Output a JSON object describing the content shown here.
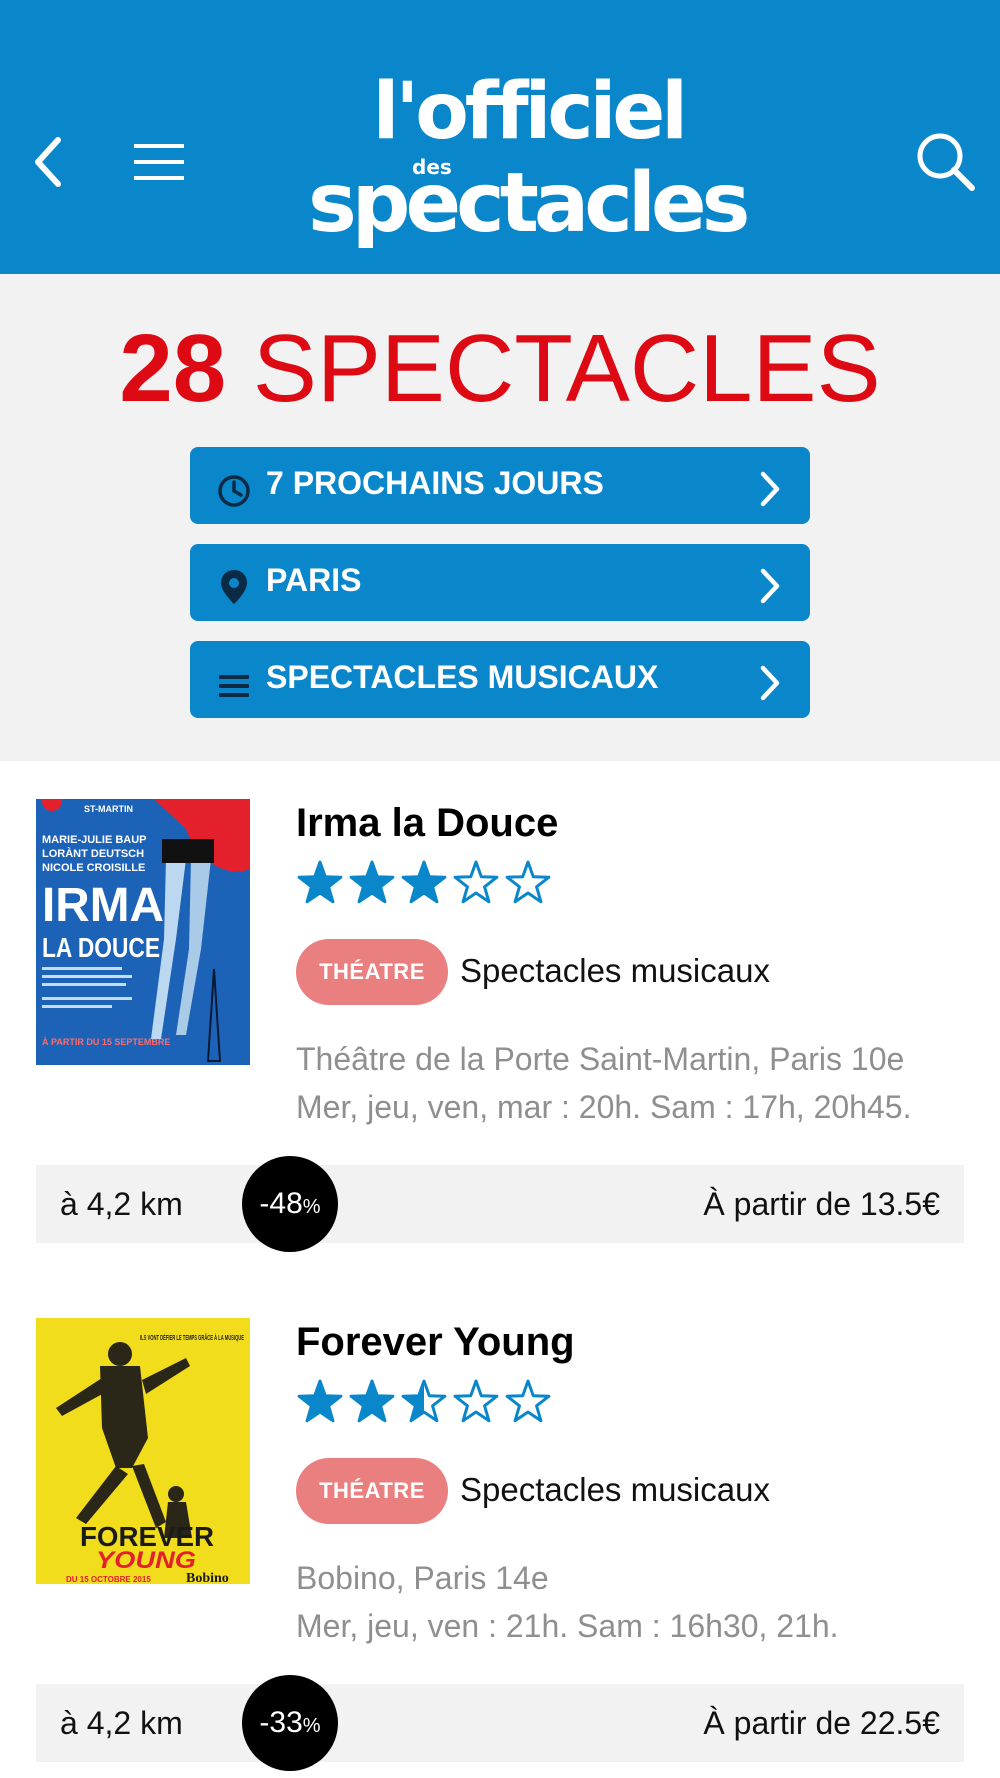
{
  "header": {
    "logo_line1": "l'officiel",
    "logo_line2": "des",
    "logo_line3": "spectacles",
    "background": "#0a87cb"
  },
  "results": {
    "count": "28",
    "label": "SPECTACLES",
    "color": "#dd0a14"
  },
  "filters": [
    {
      "label": "7 PROCHAINS JOURS",
      "icon": "clock-icon"
    },
    {
      "label": "PARIS",
      "icon": "location-pin-icon"
    },
    {
      "label": "SPECTACLES MUSICAUX",
      "icon": "list-icon"
    }
  ],
  "shows": [
    {
      "title": "Irma la Douce",
      "rating": 3,
      "rating_max": 5,
      "badge": "THÉATRE",
      "category": "Spectacles musicaux",
      "venue": "Théâtre de la Porte Saint-Martin, Paris 10e",
      "times": "Mer, jeu, ven, mar : 20h. Sam : 17h, 20h45.",
      "distance": "à 4,2 km",
      "discount": "-48",
      "discount_unit": "%",
      "price": "À partir de 13.5€",
      "poster": {
        "top": "ST-MARTIN",
        "cast": [
          "MARIE-JULIE BAUP",
          "LORÀNT DEUTSCH",
          "NICOLE CROISILLE"
        ],
        "title1": "IRMA",
        "title2": "LA DOUCE",
        "date": "À PARTIR DU 15 SEPTEMBRE"
      }
    },
    {
      "title": "Forever Young",
      "rating": 2.5,
      "rating_max": 5,
      "badge": "THÉATRE",
      "category": "Spectacles musicaux",
      "venue": "Bobino, Paris 14e",
      "times": "Mer, jeu, ven : 21h. Sam : 16h30, 21h.",
      "distance": "à 4,2 km",
      "discount": "-33",
      "discount_unit": "%",
      "price": "À partir de 22.5€",
      "poster": {
        "tagline": "ILS VONT DÉFIER LE TEMPS GRÂCE À LA MUSIQUE",
        "title1": "FOREVER",
        "title2": "YOUNG",
        "date": "DU 15 OCTOBRE 2015",
        "venue": "Bobino"
      }
    }
  ],
  "colors": {
    "accent": "#0a87cb",
    "badge": "#ea7f7f",
    "count": "#dd0a14"
  }
}
